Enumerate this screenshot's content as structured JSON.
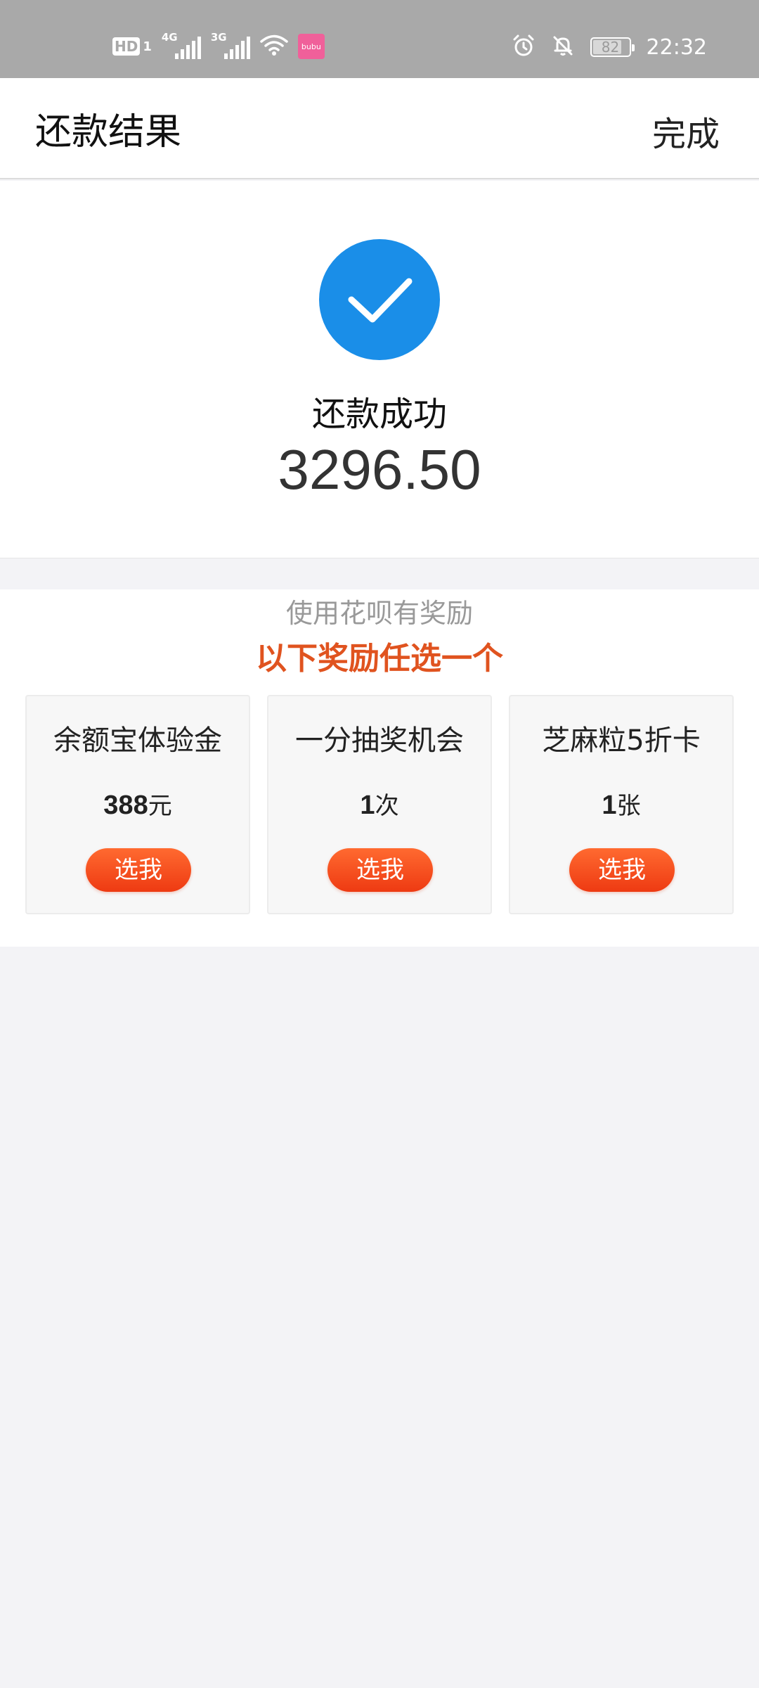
{
  "status_bar": {
    "hd": "HD",
    "sim": "1",
    "net1": "4G",
    "net2": "3G",
    "app_badge": "bubu",
    "battery": "82",
    "battery_level": 0.82,
    "time": "22:32",
    "icons": [
      "wifi-icon",
      "alarm-icon",
      "bell-off-icon",
      "battery-icon"
    ]
  },
  "nav": {
    "title": "还款结果",
    "done_label": "完成"
  },
  "result": {
    "status": "还款成功",
    "amount": "3296.50",
    "icon": "check-icon",
    "accent": "#1a8ee8"
  },
  "rewards": {
    "subtitle": "使用花呗有奖励",
    "heading": "以下奖励任选一个",
    "heading_color": "#e0531f",
    "cards": [
      {
        "title": "余额宝体验金",
        "value": "388",
        "unit": "元",
        "button": "选我"
      },
      {
        "title": "一分抽奖机会",
        "value": "1",
        "unit": "次",
        "button": "选我"
      },
      {
        "title": "芝麻粒5折卡",
        "value": "1",
        "unit": "张",
        "button": "选我"
      }
    ]
  }
}
